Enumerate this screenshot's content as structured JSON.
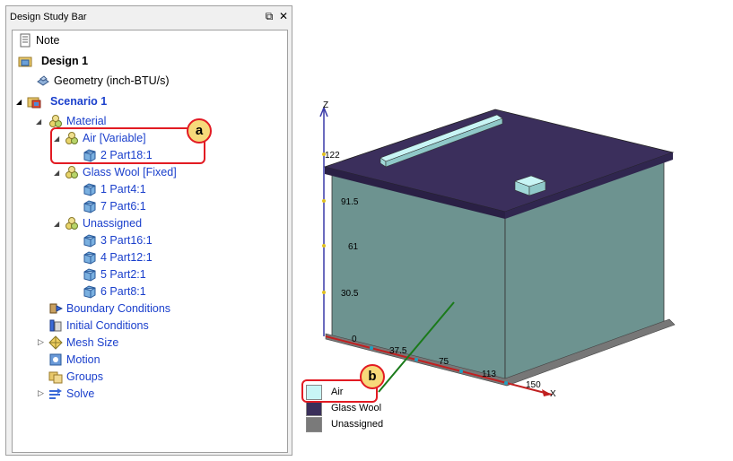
{
  "panel": {
    "title": "Design Study Bar"
  },
  "tree": {
    "note": "Note",
    "design": "Design 1",
    "geometry": "Geometry (inch-BTU/s)",
    "scenario": "Scenario 1",
    "material": "Material",
    "air_group": "Air [Variable]",
    "air_part": "2 Part18:1",
    "glass_group": "Glass Wool [Fixed]",
    "glass_parts": [
      "1 Part4:1",
      "7 Part6:1"
    ],
    "unassigned_group": "Unassigned",
    "unassigned_parts": [
      "3 Part16:1",
      "4 Part12:1",
      "5 Part2:1",
      "6 Part8:1"
    ],
    "boundary": "Boundary Conditions",
    "initial": "Initial Conditions",
    "mesh": "Mesh Size",
    "motion": "Motion",
    "groups": "Groups",
    "solve": "Solve"
  },
  "callouts": {
    "a": "a",
    "b": "b"
  },
  "viewport": {
    "z_label": "Z",
    "x_label": "X",
    "z_ticks": [
      "122",
      "91.5",
      "61",
      "30.5",
      "0"
    ],
    "x_ticks": [
      "37.5",
      "75",
      "113",
      "150"
    ]
  },
  "legend": [
    {
      "label": "Air",
      "color": "#c8f5f5"
    },
    {
      "label": "Glass Wool",
      "color": "#3a2f5a"
    },
    {
      "label": "Unassigned",
      "color": "#7a7a7a"
    }
  ],
  "colors": {
    "box_side": "#6d9390",
    "box_top": "#3b2f5c",
    "accent_red": "#e21b23",
    "link_blue": "#1a3fcc"
  }
}
